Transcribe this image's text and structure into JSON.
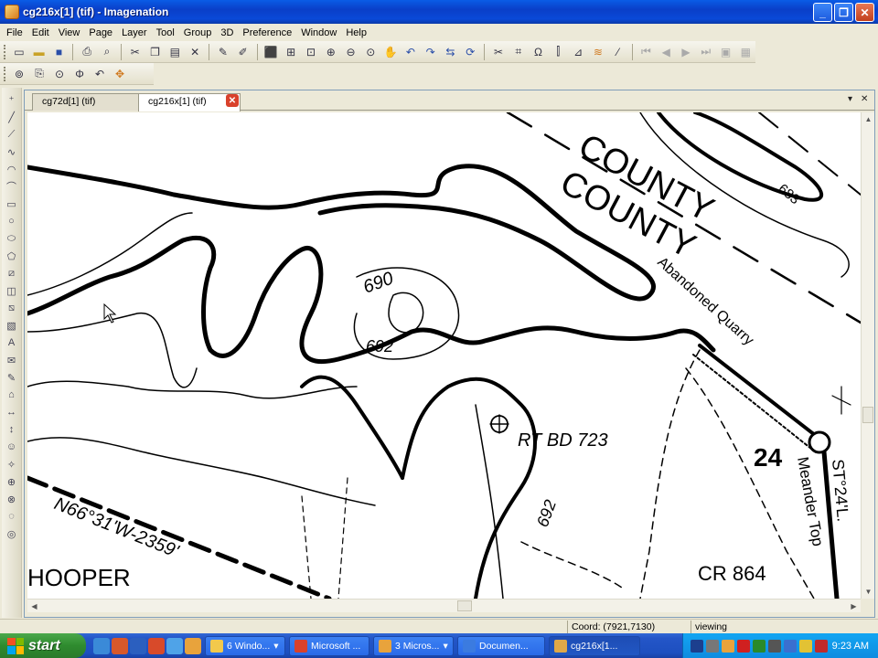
{
  "window": {
    "title": "cg216x[1]  (tif)  - Imagenation",
    "minimize_label": "_",
    "maximize_label": "❐",
    "close_label": "✕"
  },
  "menu": [
    "File",
    "Edit",
    "View",
    "Page",
    "Layer",
    "Tool",
    "Group",
    "3D",
    "Preference",
    "Window",
    "Help"
  ],
  "tabs": [
    {
      "label": "cg72d[1]  (tif)",
      "active": false
    },
    {
      "label": "cg216x[1]  (tif)",
      "active": true
    }
  ],
  "tab_controls": {
    "dropdown": "▾",
    "close": "✕"
  },
  "map_labels": {
    "county1": "COUNTY",
    "county2": "COUNTY",
    "c683": "683",
    "c690": "690",
    "c692a": "692",
    "c692b": "692",
    "quarry": "Abandoned Quarry",
    "rtbd": "RT BD 723",
    "n24": "24",
    "meander": "Meander Top",
    "st": "ST°24'L.",
    "bearing": "N66°31'W-2359'",
    "hooper": "HOOPER",
    "cr864": "CR 864"
  },
  "status": {
    "coord": "Coord: (7921,7130)",
    "mode": "viewing"
  },
  "taskbar": {
    "start": "start",
    "buttons": [
      {
        "label": "6 Windo...",
        "arrow": "▾",
        "active": false,
        "color": "#f2c94c"
      },
      {
        "label": "Microsoft ...",
        "arrow": "",
        "active": false,
        "color": "#d9412b"
      },
      {
        "label": "3 Micros...",
        "arrow": "▾",
        "active": false,
        "color": "#e8a33c"
      },
      {
        "label": "Documen...",
        "arrow": "",
        "active": false,
        "color": "#3b7be0"
      },
      {
        "label": "cg216x[1...",
        "arrow": "",
        "active": true,
        "color": "#e0a848"
      }
    ],
    "clock": "9:23 AM"
  }
}
